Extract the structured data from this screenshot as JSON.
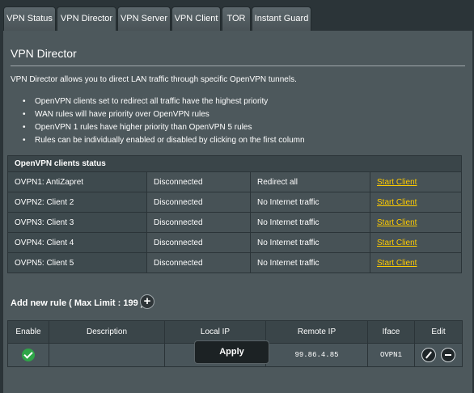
{
  "tabs": [
    {
      "label": "VPN Status"
    },
    {
      "label": "VPN Director"
    },
    {
      "label": "VPN Server"
    },
    {
      "label": "VPN Client"
    },
    {
      "label": "TOR"
    },
    {
      "label": "Instant Guard"
    }
  ],
  "page": {
    "title": "VPN Director",
    "description": "VPN Director allows you to direct LAN traffic through specific OpenVPN tunnels.",
    "bullets": [
      "OpenVPN clients set to redirect all traffic have the highest priority",
      "WAN rules will have priority over OpenVPN rules",
      "OpenVPN 1 rules have higher priority than OpenVPN 5 rules",
      "Rules can be individually enabled or disabled by clicking on the first column"
    ]
  },
  "status_table": {
    "header": "OpenVPN clients status",
    "rows": [
      {
        "client": "OVPN1: AntiZapret",
        "state": "Disconnected",
        "mode": "Redirect all",
        "action": "Start Client"
      },
      {
        "client": "OVPN2: Client 2",
        "state": "Disconnected",
        "mode": "No Internet traffic",
        "action": "Start Client"
      },
      {
        "client": "OVPN3: Client 3",
        "state": "Disconnected",
        "mode": "No Internet traffic",
        "action": "Start Client"
      },
      {
        "client": "OVPN4: Client 4",
        "state": "Disconnected",
        "mode": "No Internet traffic",
        "action": "Start Client"
      },
      {
        "client": "OVPN5: Client 5",
        "state": "Disconnected",
        "mode": "No Internet traffic",
        "action": "Start Client"
      }
    ]
  },
  "add_rule": {
    "label": "Add new rule ( Max Limit : 199 )",
    "plus": "+"
  },
  "rules_table": {
    "columns": [
      "Enable",
      "Description",
      "Local IP",
      "Remote IP",
      "Iface",
      "Edit"
    ],
    "rows": [
      {
        "enabled": true,
        "description": "",
        "local_ip": "",
        "remote_ip": "99.86.4.85",
        "iface": "OVPN1"
      }
    ]
  },
  "apply_label": "Apply",
  "colors": {
    "background": "#2b3438",
    "panel": "#4d585c",
    "link": "#ffcc00",
    "enabled": "#2fa548"
  }
}
